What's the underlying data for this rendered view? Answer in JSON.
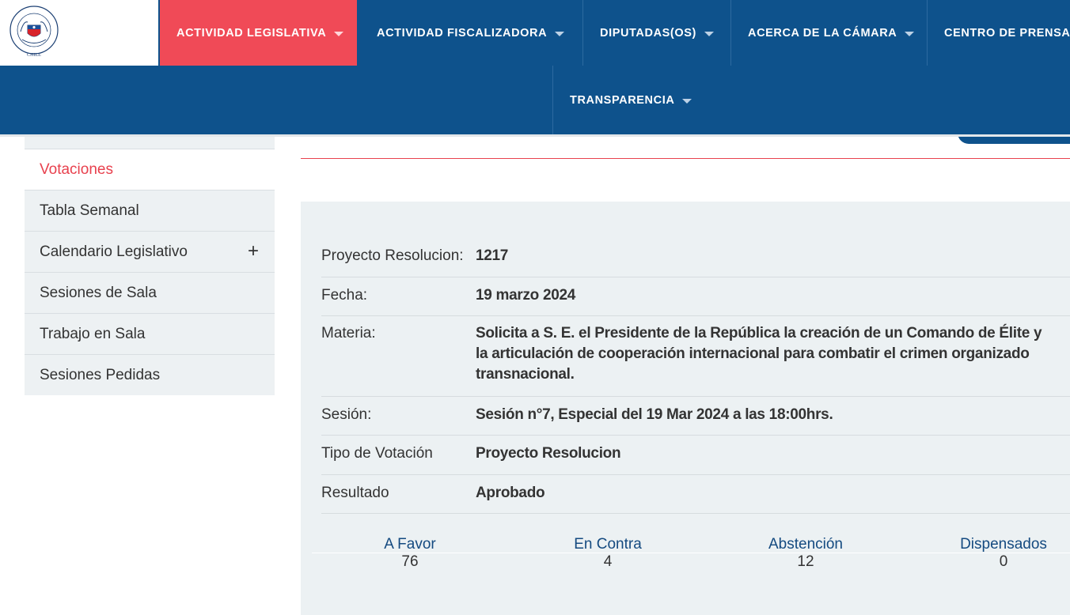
{
  "nav": {
    "items": [
      {
        "label": "ACTIVIDAD LEGISLATIVA"
      },
      {
        "label": "ACTIVIDAD FISCALIZADORA"
      },
      {
        "label": "DIPUTADAS(OS)"
      },
      {
        "label": "ACERCA DE LA CÁMARA"
      },
      {
        "label": "CENTRO DE PRENSA"
      },
      {
        "label": "TRANSPARENCIA"
      }
    ],
    "active_color": "#f04a57",
    "bar_color": "#0e528c",
    "logo_text": "CÁMARA DE DIPUTADAS Y DIPUTADOS · CHILE"
  },
  "sidebar": {
    "items": [
      {
        "label": "Votaciones"
      },
      {
        "label": "Tabla Semanal"
      },
      {
        "label": "Calendario Legislativo",
        "expand_icon": "+"
      },
      {
        "label": "Sesiones de Sala"
      },
      {
        "label": "Trabajo en Sala"
      },
      {
        "label": "Sesiones Pedidas"
      }
    ],
    "active_color": "#e8414e"
  },
  "detail": {
    "rows": [
      {
        "label": "Proyecto Resolucion:",
        "value": "1217"
      },
      {
        "label": "Fecha:",
        "value": "19 marzo 2024"
      },
      {
        "label": "Materia:",
        "value": "Solicita a S. E. el Presidente de la República la creación de un Comando de Élite y la articulación de cooperación internacional para combatir el crimen organizado transnacional."
      },
      {
        "label": "Sesión:",
        "value": "Sesión n°7, Especial del 19 Mar 2024 a las 18:00hrs."
      },
      {
        "label": "Tipo de Votación",
        "value": "Proyecto Resolucion"
      },
      {
        "label": "Resultado",
        "value": "Aprobado"
      }
    ]
  },
  "stats": [
    {
      "title": "A Favor",
      "value": "76"
    },
    {
      "title": "En Contra",
      "value": "4"
    },
    {
      "title": "Abstención",
      "value": "12"
    },
    {
      "title": "Dispensados",
      "value": "0"
    }
  ]
}
